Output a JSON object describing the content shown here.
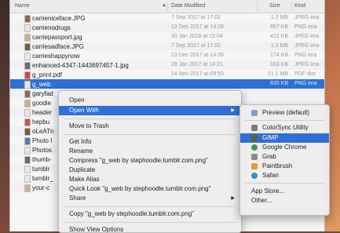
{
  "columns": {
    "name": "Name",
    "date": "Date Modified",
    "size": "Size",
    "kind": "Kind"
  },
  "files": [
    {
      "name": "carrieniceface.JPG",
      "date": "7 Sep 2017 at 17:02",
      "size": "1.2 MB",
      "kind": "JPEG ima",
      "icon_color": "#8a6a4a"
    },
    {
      "name": "carrienodrugs",
      "date": "13 Dec 2017 at 14:26",
      "size": "857 KB",
      "kind": "PNG ima",
      "icon_color": "#e8e8e8"
    },
    {
      "name": "carriepassport.jpg",
      "date": "30 Jan 2018 at 15:04",
      "size": "421 KB",
      "kind": "JPEG ima",
      "icon_color": "#c9b28a"
    },
    {
      "name": "carriesadface.JPG",
      "date": "7 Sep 2017 at 17:02",
      "size": "1.3 MB",
      "kind": "JPEG ima",
      "icon_color": "#7a5a3a"
    },
    {
      "name": "carrieshappynow",
      "date": "13 Dec 2017 at 14:35",
      "size": "174 KB",
      "kind": "PNG ima",
      "icon_color": "#e8e8e8"
    },
    {
      "name": "enhanced-4347-1443697457-1.jpg",
      "date": "28 Jan 2017 at 14:21",
      "size": "163 KB",
      "kind": "JPEG ima",
      "icon_color": "#6a6a7a"
    },
    {
      "name": "g_print.pdf",
      "date": "14 Nov 2017 at 09:50",
      "size": "21.1 MB",
      "kind": "PDF doc",
      "icon_color": "#d44"
    },
    {
      "name": "g_web",
      "date": "",
      "size": "835 KB",
      "kind": "PNG ima",
      "icon_color": "#e8e8e8"
    },
    {
      "name": "garyfad",
      "date": "",
      "size": "",
      "kind": "",
      "icon_color": "#8a6a4a"
    },
    {
      "name": "goodie",
      "date": "",
      "size": "",
      "kind": "",
      "icon_color": "#c9b28a"
    },
    {
      "name": "header",
      "date": "",
      "size": "",
      "kind": "",
      "icon_color": "#e8e8e8"
    },
    {
      "name": "hepbu",
      "date": "",
      "size": "",
      "kind": "",
      "icon_color": "#c55"
    },
    {
      "name": "oLeATn",
      "date": "",
      "size": "",
      "kind": "",
      "icon_color": "#7a5a3a"
    },
    {
      "name": "Photo I",
      "date": "",
      "size": "",
      "kind": "",
      "icon_color": "#5a7aaa"
    },
    {
      "name": "Photos",
      "date": "",
      "size": "",
      "kind": "",
      "icon_color": "#e8e8e8"
    },
    {
      "name": "thumb-",
      "date": "",
      "size": "",
      "kind": "",
      "icon_color": "#6a6a6a"
    },
    {
      "name": "tumblr",
      "date": "",
      "size": "",
      "kind": "",
      "icon_color": "#e8e8e8"
    },
    {
      "name": "tumblr_",
      "date": "",
      "size": "",
      "kind": "",
      "icon_color": "#e8e8e8"
    },
    {
      "name": "your-c",
      "date": "",
      "size": "",
      "kind": "",
      "icon_color": "#c9b28a"
    }
  ],
  "context_menu": {
    "open": "Open",
    "open_with": "Open With",
    "move_to_trash": "Move to Trash",
    "get_info": "Get Info",
    "rename": "Rename",
    "compress": "Compress \"g_web by stephoodle.tumblr.com.png\"",
    "duplicate": "Duplicate",
    "make_alias": "Make Alias",
    "quick_look": "Quick Look \"g_web by stephoodle.tumblr.com.png\"",
    "share": "Share",
    "copy": "Copy \"g_web by stephoodle.tumblr.com.png\"",
    "show_view_options": "Show View Options"
  },
  "submenu": {
    "preview": "Preview (default)",
    "colorsync": "ColorSync Utility",
    "gimp": "GIMP",
    "chrome": "Google Chrome",
    "grab": "Grab",
    "paintbrush": "Paintbrush",
    "safari": "Safari",
    "app_store": "App Store...",
    "other": "Other..."
  },
  "colors": {
    "selection": "#2f6fd6"
  }
}
